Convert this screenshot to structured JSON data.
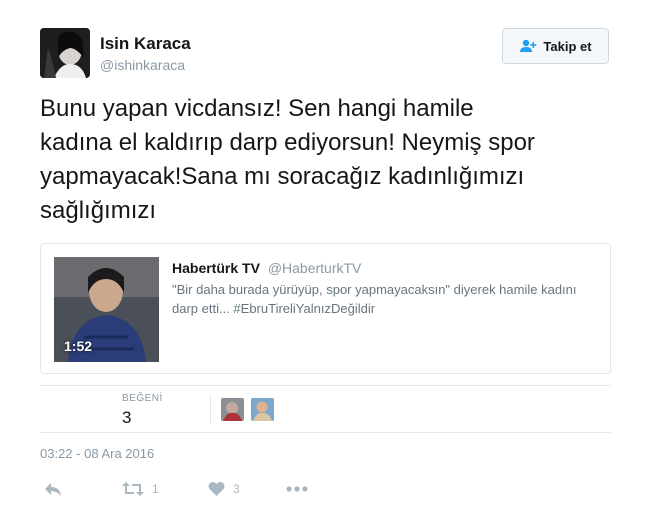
{
  "user": {
    "name": "Isin Karaca",
    "handle": "@ishinkaraca"
  },
  "follow_button": {
    "label": "Takip et"
  },
  "tweet": {
    "lines": [
      "Bunu yapan vicdansız! Sen hangi hamile",
      "kadına el kaldırıp darp ediyorsun! Neymiş spor",
      "yapmayacak!Sana mı soracağız kadınlığımızı",
      "sağlığımızı"
    ]
  },
  "quote": {
    "author_name": "Habertürk TV",
    "author_handle": "@HaberturkTV",
    "text": "\"Bir daha burada yürüyüp, spor yapmayacaksın\"  diyerek hamile kadını darp etti... #EbruTireliYalnızDeğildir",
    "video_duration": "1:52"
  },
  "stats": {
    "likes_label": "BEĞENİ",
    "likes_value": "3"
  },
  "timestamp": "03:22 - 08 Ara 2016",
  "actions": {
    "retweet_count": "1",
    "like_count": "3"
  },
  "icons": {
    "follow": "add-user-icon",
    "reply": "reply-icon",
    "retweet": "retweet-icon",
    "like": "heart-icon",
    "more": "more-icon"
  },
  "colors": {
    "text": "#14171a",
    "muted": "#8899a6",
    "border": "#e1e8ed",
    "action_icon": "#aab8c2",
    "follow_icon": "#1da1f2"
  }
}
